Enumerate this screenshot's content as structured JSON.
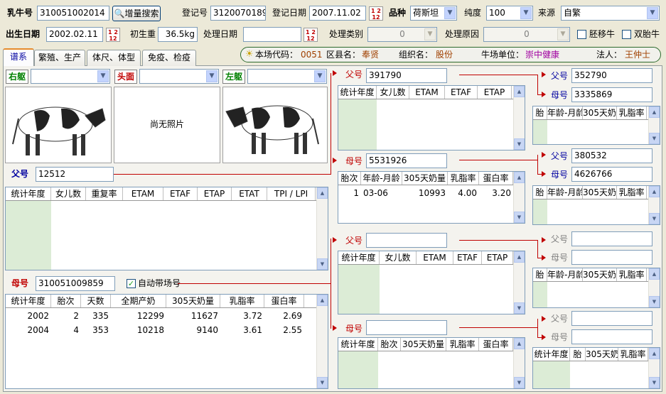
{
  "header": {
    "cow_no_label": "乳牛号",
    "cow_no": "310051002014",
    "search_btn": "增量搜索",
    "reg_no_label": "登记号",
    "reg_no": "3120070189",
    "reg_date_label": "登记日期",
    "reg_date": "2007.11.02",
    "breed_label": "品种",
    "breed": "荷斯坦",
    "purity_label": "纯度",
    "purity": "100",
    "source_label": "来源",
    "source": "自繁",
    "birth_date_label": "出生日期",
    "birth_date": "2002.02.11",
    "birth_weight_label": "初生重",
    "birth_weight": "36.5kg",
    "proc_date_label": "处理日期",
    "proc_date": "",
    "proc_type_label": "处理类别",
    "proc_type": "0",
    "proc_reason_label": "处理原因",
    "proc_reason": "0",
    "embryo_label": "胚移牛",
    "twin_label": "双胎牛"
  },
  "tabs": [
    "谱系",
    "繁殖、生产",
    "体尺、体型",
    "免疫、检疫"
  ],
  "info": {
    "farm_code_label": "本场代码：",
    "farm_code": "0051",
    "district_label": "区县名：",
    "district": "奉贤",
    "org_label": "组织名：",
    "org": "股份",
    "unit_label": "牛场单位：",
    "unit": "崇中健康",
    "legal_label": "法人：",
    "legal": "王仲士"
  },
  "photos": {
    "right_label": "右躯",
    "head_label": "头面",
    "left_label": "左躯",
    "no_photo": "尚无照片"
  },
  "sire": {
    "label": "父号",
    "value": "12512",
    "headers": [
      "统计年度",
      "女儿数",
      "重复率",
      "ETAM",
      "ETAF",
      "ETAP",
      "ETAT",
      "TPI / LPI"
    ]
  },
  "dam": {
    "label": "母号",
    "value": "310051009859",
    "auto_label": "自动带场号",
    "headers": [
      "统计年度",
      "胎次",
      "天数",
      "全期产奶",
      "305天奶量",
      "乳脂率",
      "蛋白率"
    ],
    "rows": [
      [
        "2002",
        "2",
        "335",
        "12299",
        "11627",
        "3.72",
        "2.69"
      ],
      [
        "2004",
        "4",
        "353",
        "10218",
        "9140",
        "3.61",
        "2.55"
      ]
    ]
  },
  "ss": {
    "label": "父号",
    "value": "391790",
    "headers": [
      "统计年度",
      "女儿数",
      "ETAM",
      "ETAF",
      "ETAP"
    ]
  },
  "sd": {
    "label": "母号",
    "value": "5531926",
    "headers": [
      "胎次",
      "年龄-月龄",
      "305天奶量",
      "乳脂率",
      "蛋白率"
    ],
    "rows": [
      [
        "1",
        "03-06",
        "10993",
        "4.00",
        "3.20"
      ]
    ]
  },
  "sss": {
    "label": "父号",
    "value": "352790"
  },
  "ssd": {
    "label": "母号",
    "value": "3335869",
    "headers": [
      "胎",
      "年龄-月龄",
      "305天奶",
      "乳脂率"
    ]
  },
  "sds": {
    "label": "父号",
    "value": "380532"
  },
  "sdd": {
    "label": "母号",
    "value": "4626766",
    "headers": [
      "胎",
      "年龄-月龄",
      "305天奶",
      "乳脂率"
    ]
  },
  "ds": {
    "label": "父号",
    "value": "",
    "headers": [
      "统计年度",
      "女儿数",
      "ETAM",
      "ETAF",
      "ETAP"
    ]
  },
  "dd": {
    "label": "母号",
    "value": "",
    "headers": [
      "统计年度",
      "胎次",
      "305天奶量",
      "乳脂率",
      "蛋白率"
    ]
  },
  "dss": {
    "label": "父号",
    "value": ""
  },
  "dsd": {
    "label": "母号",
    "value": "",
    "headers": [
      "胎",
      "年龄-月龄",
      "305天奶",
      "乳脂率"
    ]
  },
  "dds": {
    "label": "父号",
    "value": ""
  },
  "ddd": {
    "label": "母号",
    "value": "",
    "headers": [
      "统计年度",
      "胎",
      "305天奶",
      "乳脂率"
    ]
  }
}
